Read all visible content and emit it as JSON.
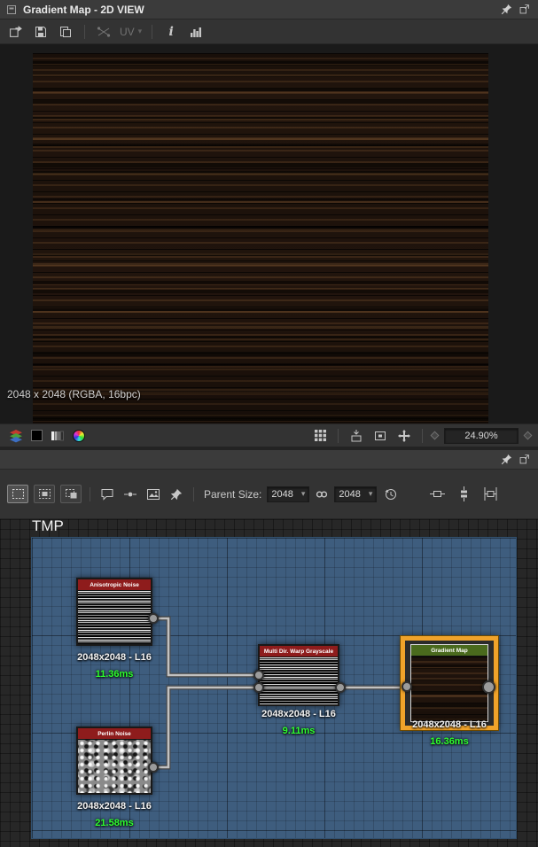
{
  "view2d": {
    "title": "Gradient Map - 2D VIEW",
    "toolbar": {
      "uv_label": "UV"
    },
    "status": "2048 x 2048 (RGBA, 16bpc)",
    "zoom_level": "24.90%"
  },
  "graph_panel": {
    "graph_name": "TMP",
    "toolbar": {
      "parent_size_label": "Parent Size:",
      "parent_width": "2048",
      "parent_height": "2048"
    },
    "nodes": [
      {
        "title": "Anisotropic Noise",
        "resolution": "2048x2048 - L16",
        "compute_time": "11.36ms"
      },
      {
        "title": "Perlin Noise",
        "resolution": "2048x2048 - L16",
        "compute_time": "21.58ms"
      },
      {
        "title": "Multi Dir. Warp Grayscale",
        "resolution": "2048x2048 - L16",
        "compute_time": "9.11ms"
      },
      {
        "title": "Gradient Map",
        "resolution": "2048x2048 - L16",
        "compute_time": "16.36ms",
        "selected": true
      }
    ]
  },
  "icons": {
    "chevron_down": "▾"
  },
  "colors": {
    "selection_orange": "#f0a32a",
    "node_header_red": "#8e1c1c",
    "node_header_green": "#4a6a1d",
    "compute_time_green": "#2eff2e",
    "canvas_blue": "#3e5d7e"
  }
}
